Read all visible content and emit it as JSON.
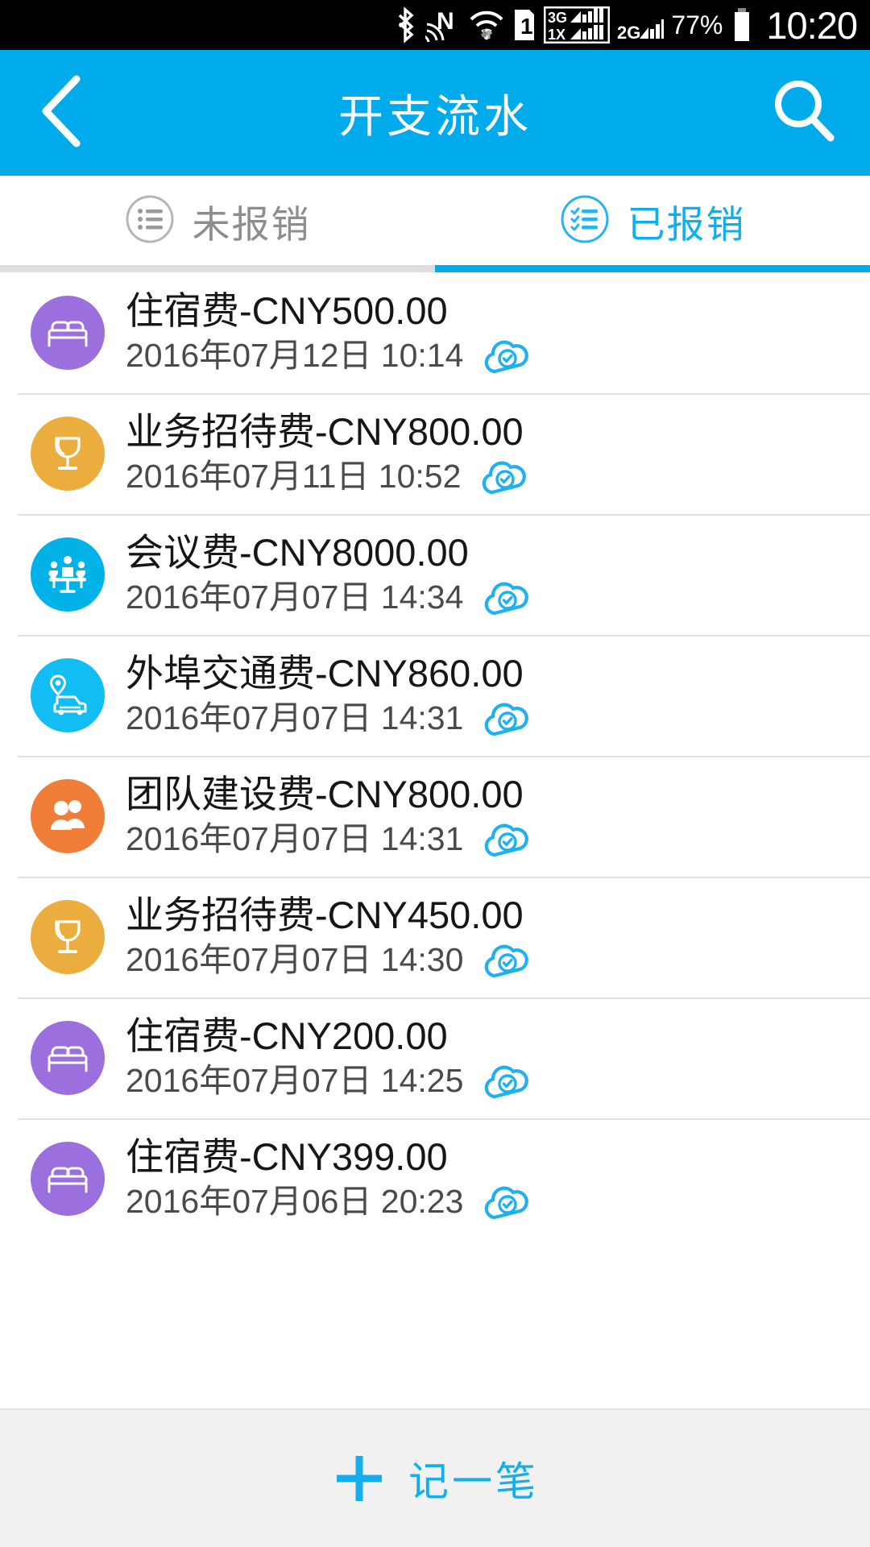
{
  "status_bar": {
    "icons": [
      "bluetooth-icon",
      "nfc-icon",
      "wifi-icon",
      "sim1-icon",
      "signal-3g-1x-icon",
      "signal-2g-icon"
    ],
    "battery_percent": "77%",
    "battery_icon": "battery-icon",
    "time": "10:20"
  },
  "app_bar": {
    "back_icon": "chevron-left-icon",
    "title": "开支流水",
    "search_icon": "search-icon"
  },
  "tabs": [
    {
      "label": "未报销",
      "icon": "list-lines-icon",
      "active": false
    },
    {
      "label": "已报销",
      "icon": "list-check-icon",
      "active": true
    }
  ],
  "colors": {
    "brand_blue": "#00ABEC",
    "accent_blue": "#0FAFEE",
    "purple": "#9B6FDD",
    "amber": "#EBAE3E",
    "cyan": "#00B2E8",
    "orange": "#F07E38",
    "divider": "#E2E2E2",
    "bottom_bg": "#F1F1F1"
  },
  "list": {
    "items": [
      {
        "title": "住宿费-CNY500.00",
        "date": "2016年07月12日 10:14",
        "icon": "bed-icon",
        "color": "#9B6FDD",
        "status_icon": "cloud-check-icon"
      },
      {
        "title": "业务招待费-CNY800.00",
        "date": "2016年07月11日 10:52",
        "icon": "wine-glass-icon",
        "color": "#EBAE3E",
        "status_icon": "cloud-check-icon"
      },
      {
        "title": "会议费-CNY8000.00",
        "date": "2016年07月07日 14:34",
        "icon": "meeting-icon",
        "color": "#00B2E8",
        "status_icon": "cloud-check-icon"
      },
      {
        "title": "外埠交通费-CNY860.00",
        "date": "2016年07月07日 14:31",
        "icon": "pin-car-icon",
        "color": "#11BDF3",
        "status_icon": "cloud-check-icon"
      },
      {
        "title": "团队建设费-CNY800.00",
        "date": "2016年07月07日 14:31",
        "icon": "people-icon",
        "color": "#F07E38",
        "status_icon": "cloud-check-icon"
      },
      {
        "title": "业务招待费-CNY450.00",
        "date": "2016年07月07日 14:30",
        "icon": "wine-glass-icon",
        "color": "#EBAE3E",
        "status_icon": "cloud-check-icon"
      },
      {
        "title": "住宿费-CNY200.00",
        "date": "2016年07月07日 14:25",
        "icon": "bed-icon",
        "color": "#9B6FDD",
        "status_icon": "cloud-check-icon"
      },
      {
        "title": "住宿费-CNY399.00",
        "date": "2016年07月06日 20:23",
        "icon": "bed-icon",
        "color": "#9B6FDD",
        "status_icon": "cloud-check-icon"
      }
    ]
  },
  "bottom_bar": {
    "add_icon": "plus-icon",
    "add_label": "记一笔"
  }
}
